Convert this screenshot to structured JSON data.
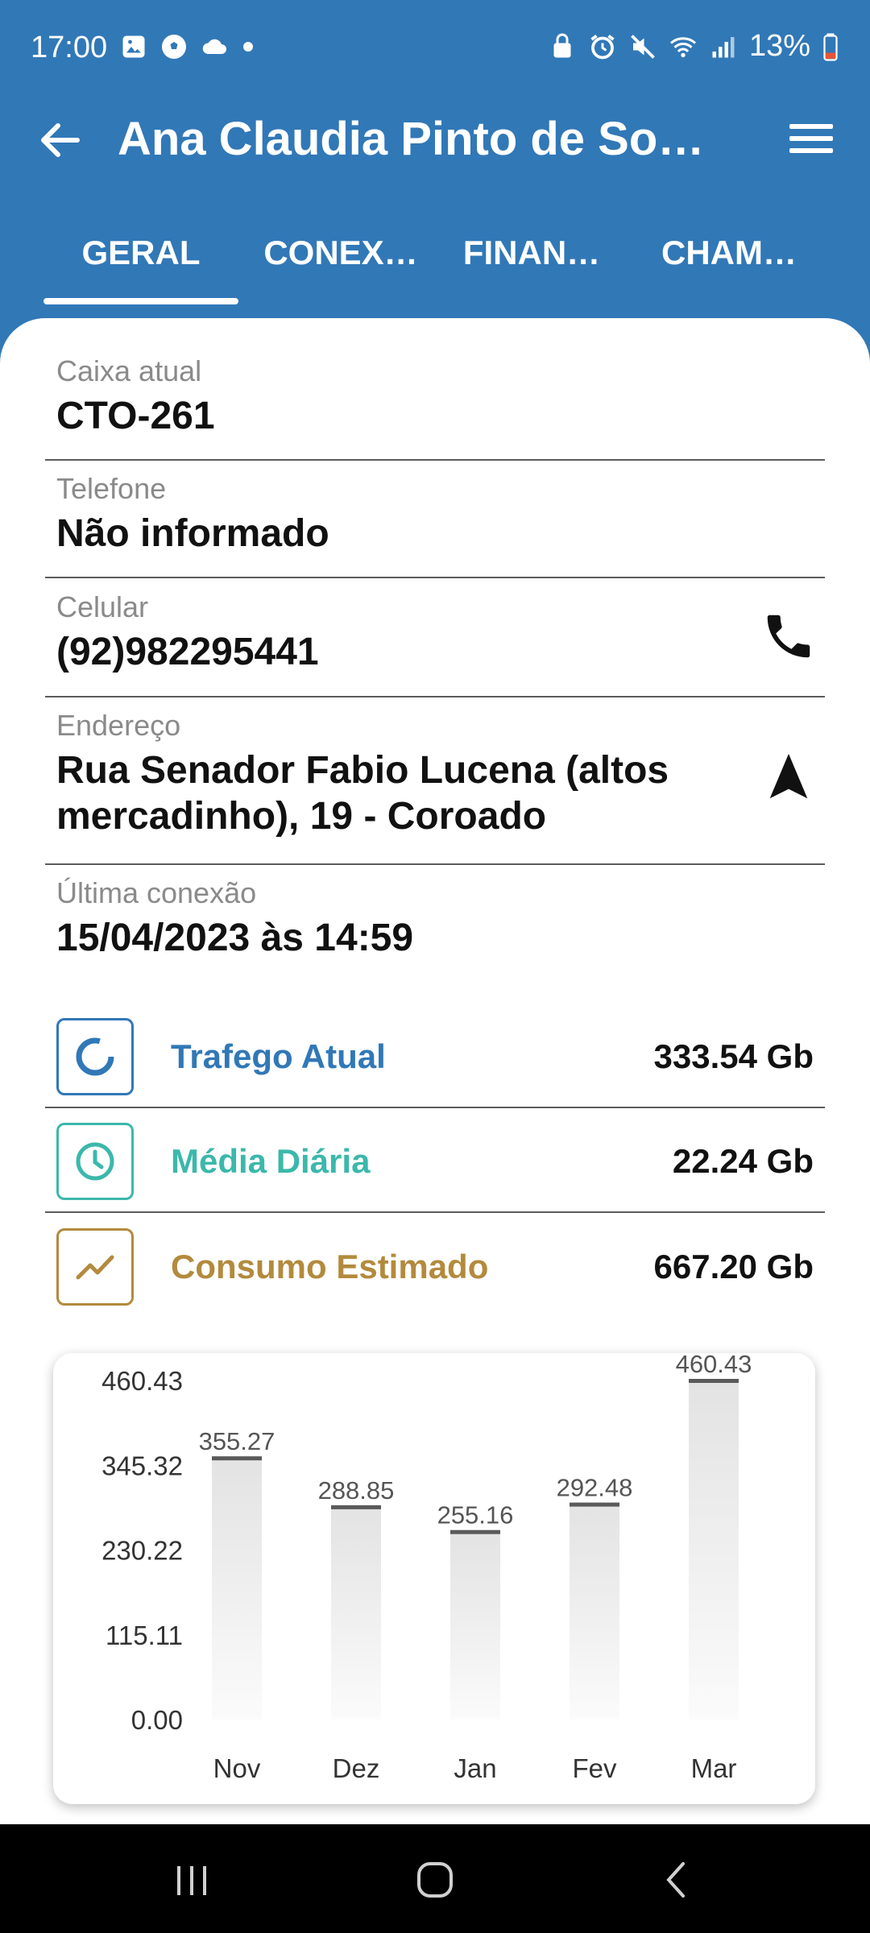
{
  "status_bar": {
    "time": "17:00",
    "battery": "13%",
    "left_icons": [
      "gallery-icon",
      "soccer-ball-icon",
      "cloud-icon",
      "dot-icon"
    ],
    "right_icons": [
      "lock-icon",
      "alarm-icon",
      "mute-icon",
      "wifi-icon",
      "signal-icon",
      "battery-icon"
    ]
  },
  "app_bar": {
    "title": "Ana Claudia Pinto de So…",
    "back_icon": "arrow-left-icon",
    "menu_icon": "hamburger-menu-icon"
  },
  "tabs": [
    {
      "label": "GERAL",
      "active": true
    },
    {
      "label": "CONEX…",
      "active": false
    },
    {
      "label": "FINAN…",
      "active": false
    },
    {
      "label": "CHAM…",
      "active": false
    }
  ],
  "fields": {
    "caixa": {
      "label": "Caixa atual",
      "value": "CTO-261"
    },
    "telefone": {
      "label": "Telefone",
      "value": "Não informado"
    },
    "celular": {
      "label": "Celular",
      "value": "(92)982295441",
      "action_icon": "phone-icon"
    },
    "endereco": {
      "label": "Endereço",
      "value_line1": "Rua Senador Fabio Lucena (altos",
      "value_line2": "mercadinho), 19 - Coroado",
      "action_icon": "navigation-arrow-icon"
    },
    "ultima_conexao": {
      "label": "Última conexão",
      "value": "15/04/2023 às 14:59"
    }
  },
  "stats": {
    "trafego": {
      "label": "Trafego Atual",
      "value": "333.54 Gb",
      "color": "#3178b7",
      "icon": "donut-chart-icon"
    },
    "media": {
      "label": "Média Diária",
      "value": "22.24 Gb",
      "color": "#3bb8ab",
      "icon": "clock-icon"
    },
    "consumo": {
      "label": "Consumo Estimado",
      "value": "667.20 Gb",
      "color": "#b38a3d",
      "icon": "trending-line-icon"
    }
  },
  "chart_data": {
    "type": "bar",
    "categories": [
      "Nov",
      "Dez",
      "Jan",
      "Fev",
      "Mar"
    ],
    "values": [
      355.27,
      288.85,
      255.16,
      292.48,
      460.43
    ],
    "value_labels": [
      "355.27",
      "288.85",
      "255.16",
      "292.48",
      "460.43"
    ],
    "y_ticks": [
      "460.43",
      "345.32",
      "230.22",
      "115.11",
      "0.00"
    ],
    "ylim": [
      0,
      460.43
    ],
    "title": "",
    "xlabel": "",
    "ylabel": ""
  },
  "nav_bar": {
    "icons": [
      "recent-apps-icon",
      "home-icon",
      "back-icon"
    ]
  }
}
